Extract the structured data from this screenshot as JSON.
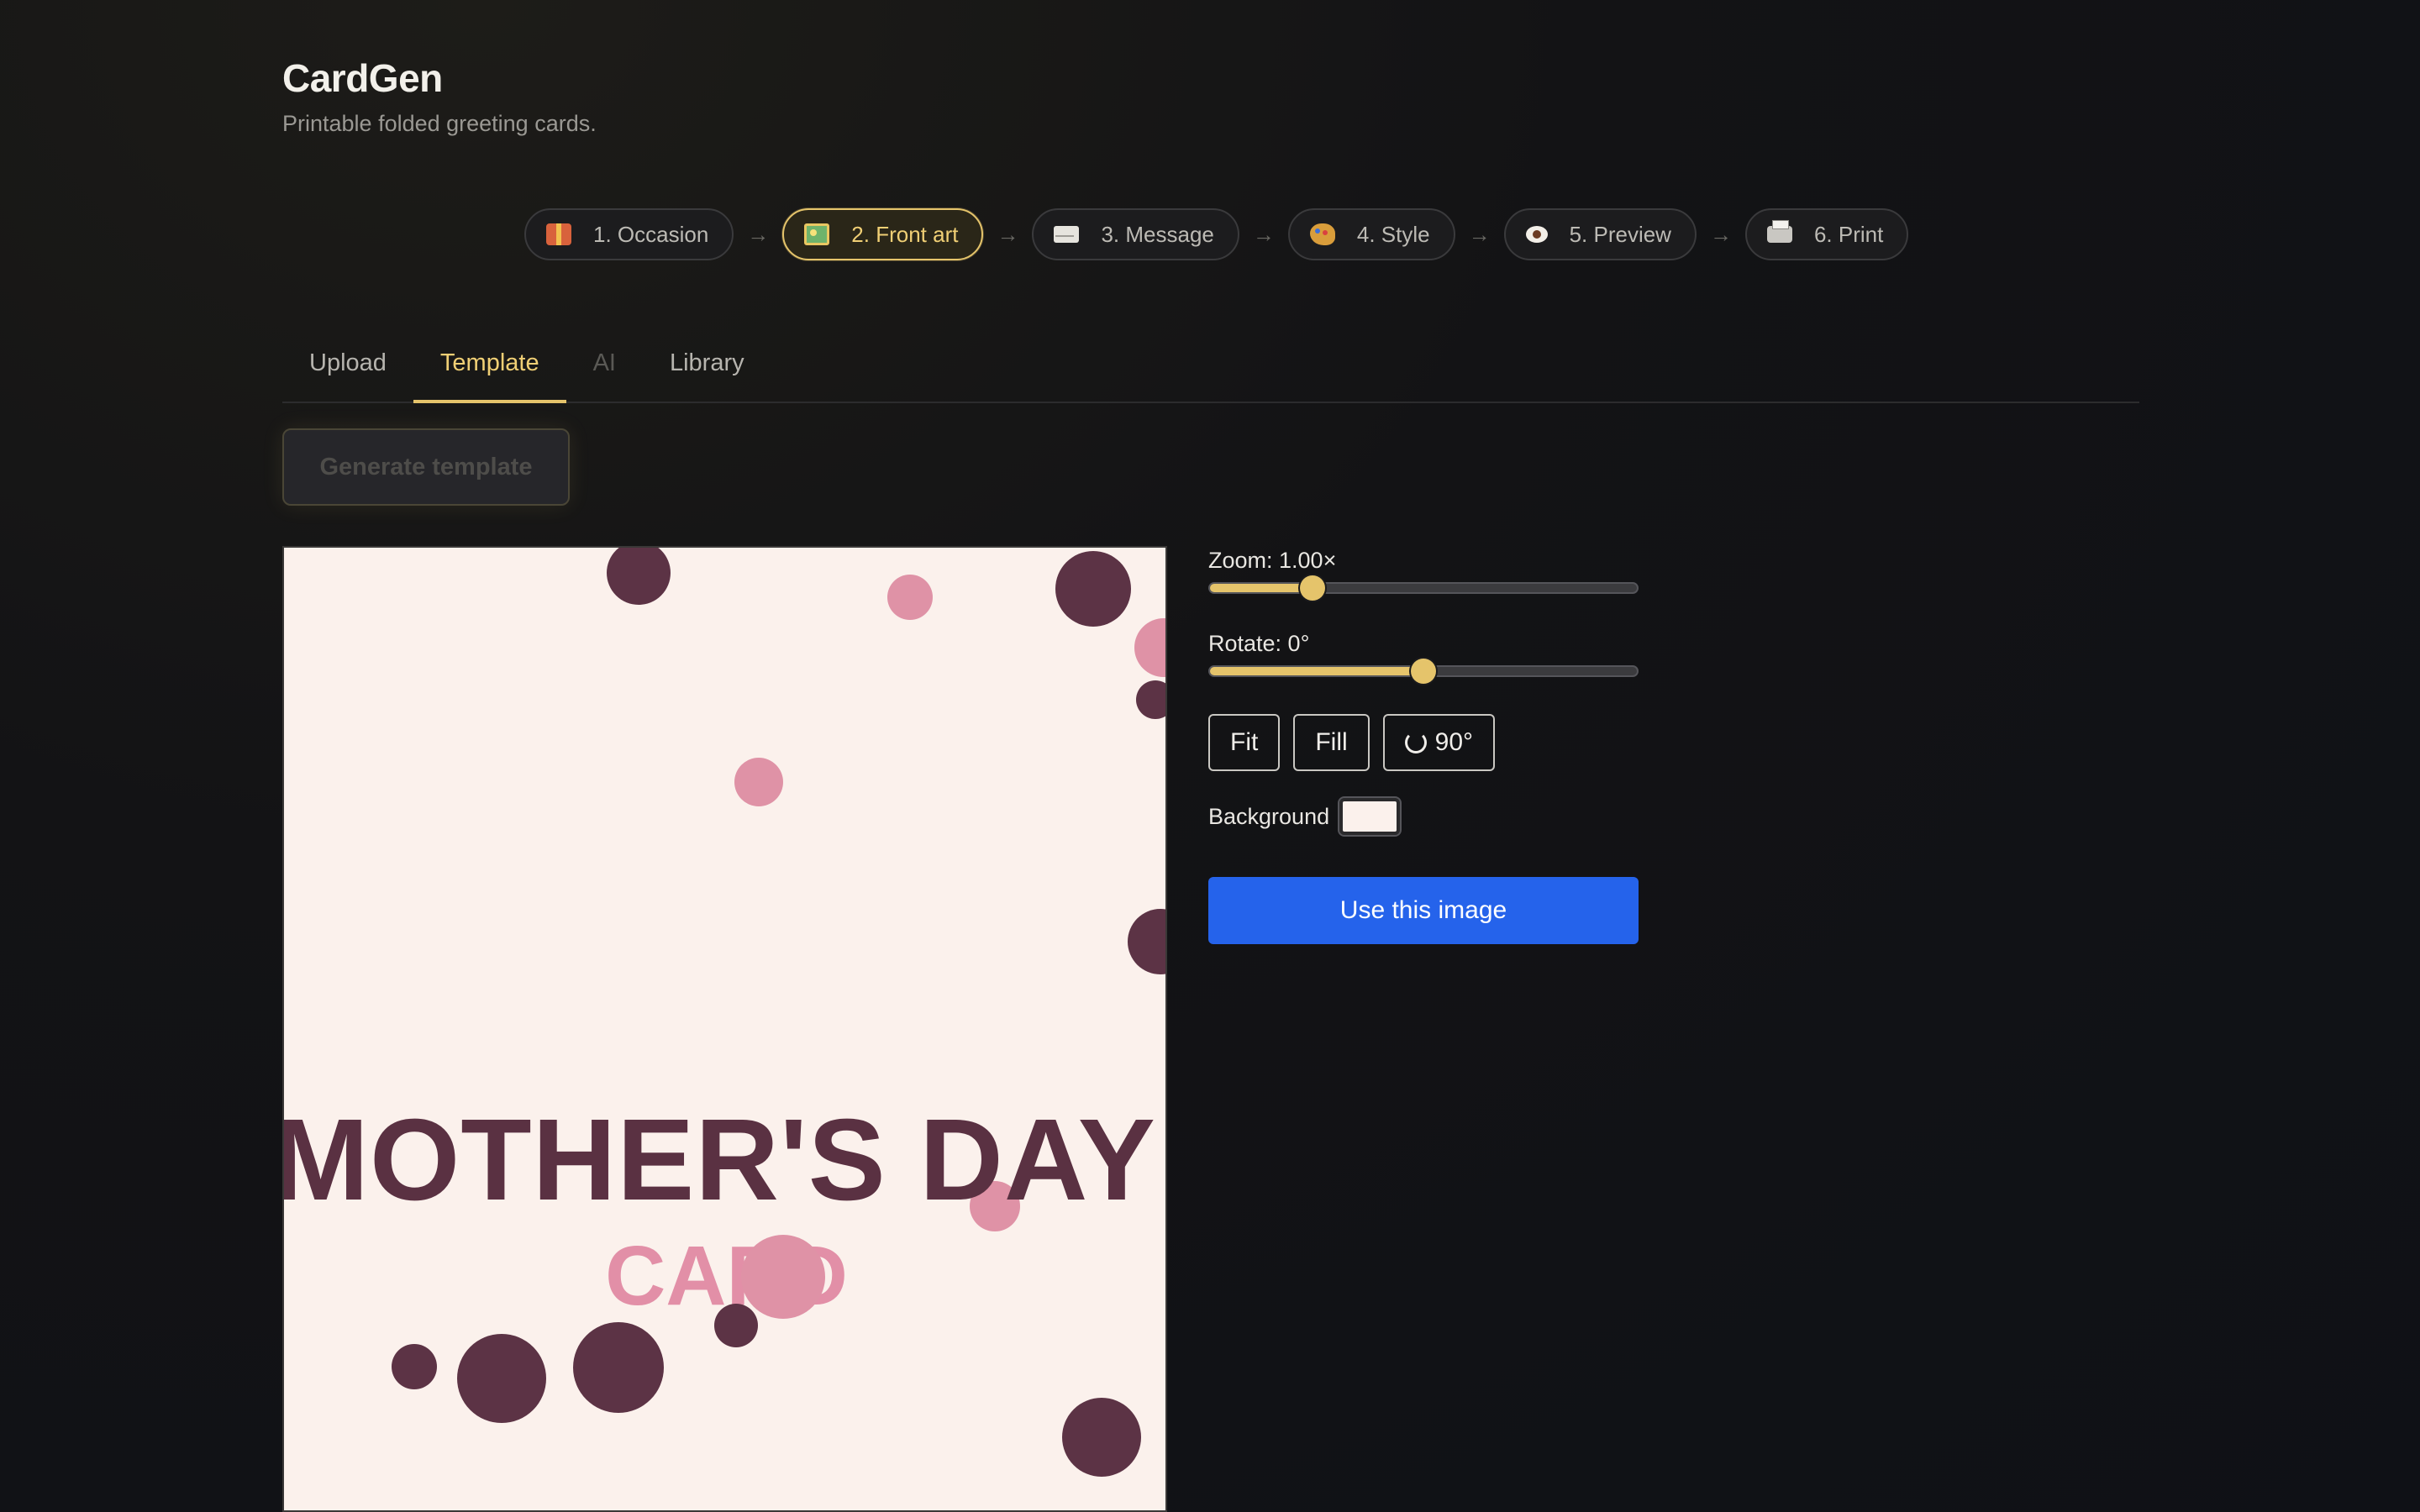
{
  "app": {
    "title": "CardGen",
    "subtitle": "Printable folded greeting cards."
  },
  "stepper": {
    "arrow": "→",
    "steps": [
      {
        "label": "1. Occasion",
        "icon": "gift-icon",
        "active": false
      },
      {
        "label": "2. Front art",
        "icon": "image-icon",
        "active": true
      },
      {
        "label": "3. Message",
        "icon": "envelope-icon",
        "active": false
      },
      {
        "label": "4. Style",
        "icon": "palette-icon",
        "active": false
      },
      {
        "label": "5. Preview",
        "icon": "eye-icon",
        "active": false
      },
      {
        "label": "6. Print",
        "icon": "printer-icon",
        "active": false
      }
    ]
  },
  "tabs": [
    {
      "label": "Upload",
      "state": "normal"
    },
    {
      "label": "Template",
      "state": "active"
    },
    {
      "label": "AI",
      "state": "disabled"
    },
    {
      "label": "Library",
      "state": "normal"
    }
  ],
  "generate_button": {
    "label": "Generate template",
    "disabled": true
  },
  "artwork": {
    "title": "MOTHER'S DAY",
    "subtitle": "CARD",
    "background_color": "#fbf1ec",
    "dot_colors": {
      "dark": "#5c3345",
      "pink": "#df92a6"
    }
  },
  "controls": {
    "zoom": {
      "label": "Zoom: 1.00×",
      "value": 1.0,
      "fraction": 0.24
    },
    "rotate": {
      "label": "Rotate: 0°",
      "value": 0,
      "fraction": 0.5
    },
    "fit_label": "Fit",
    "fill_label": "Fill",
    "rotate90_label": "90°",
    "background_label": "Background",
    "background_value": "#fbf1ec",
    "use_label": "Use this image"
  },
  "colors": {
    "accent": "#e5c46b",
    "primary": "#2563eb"
  }
}
